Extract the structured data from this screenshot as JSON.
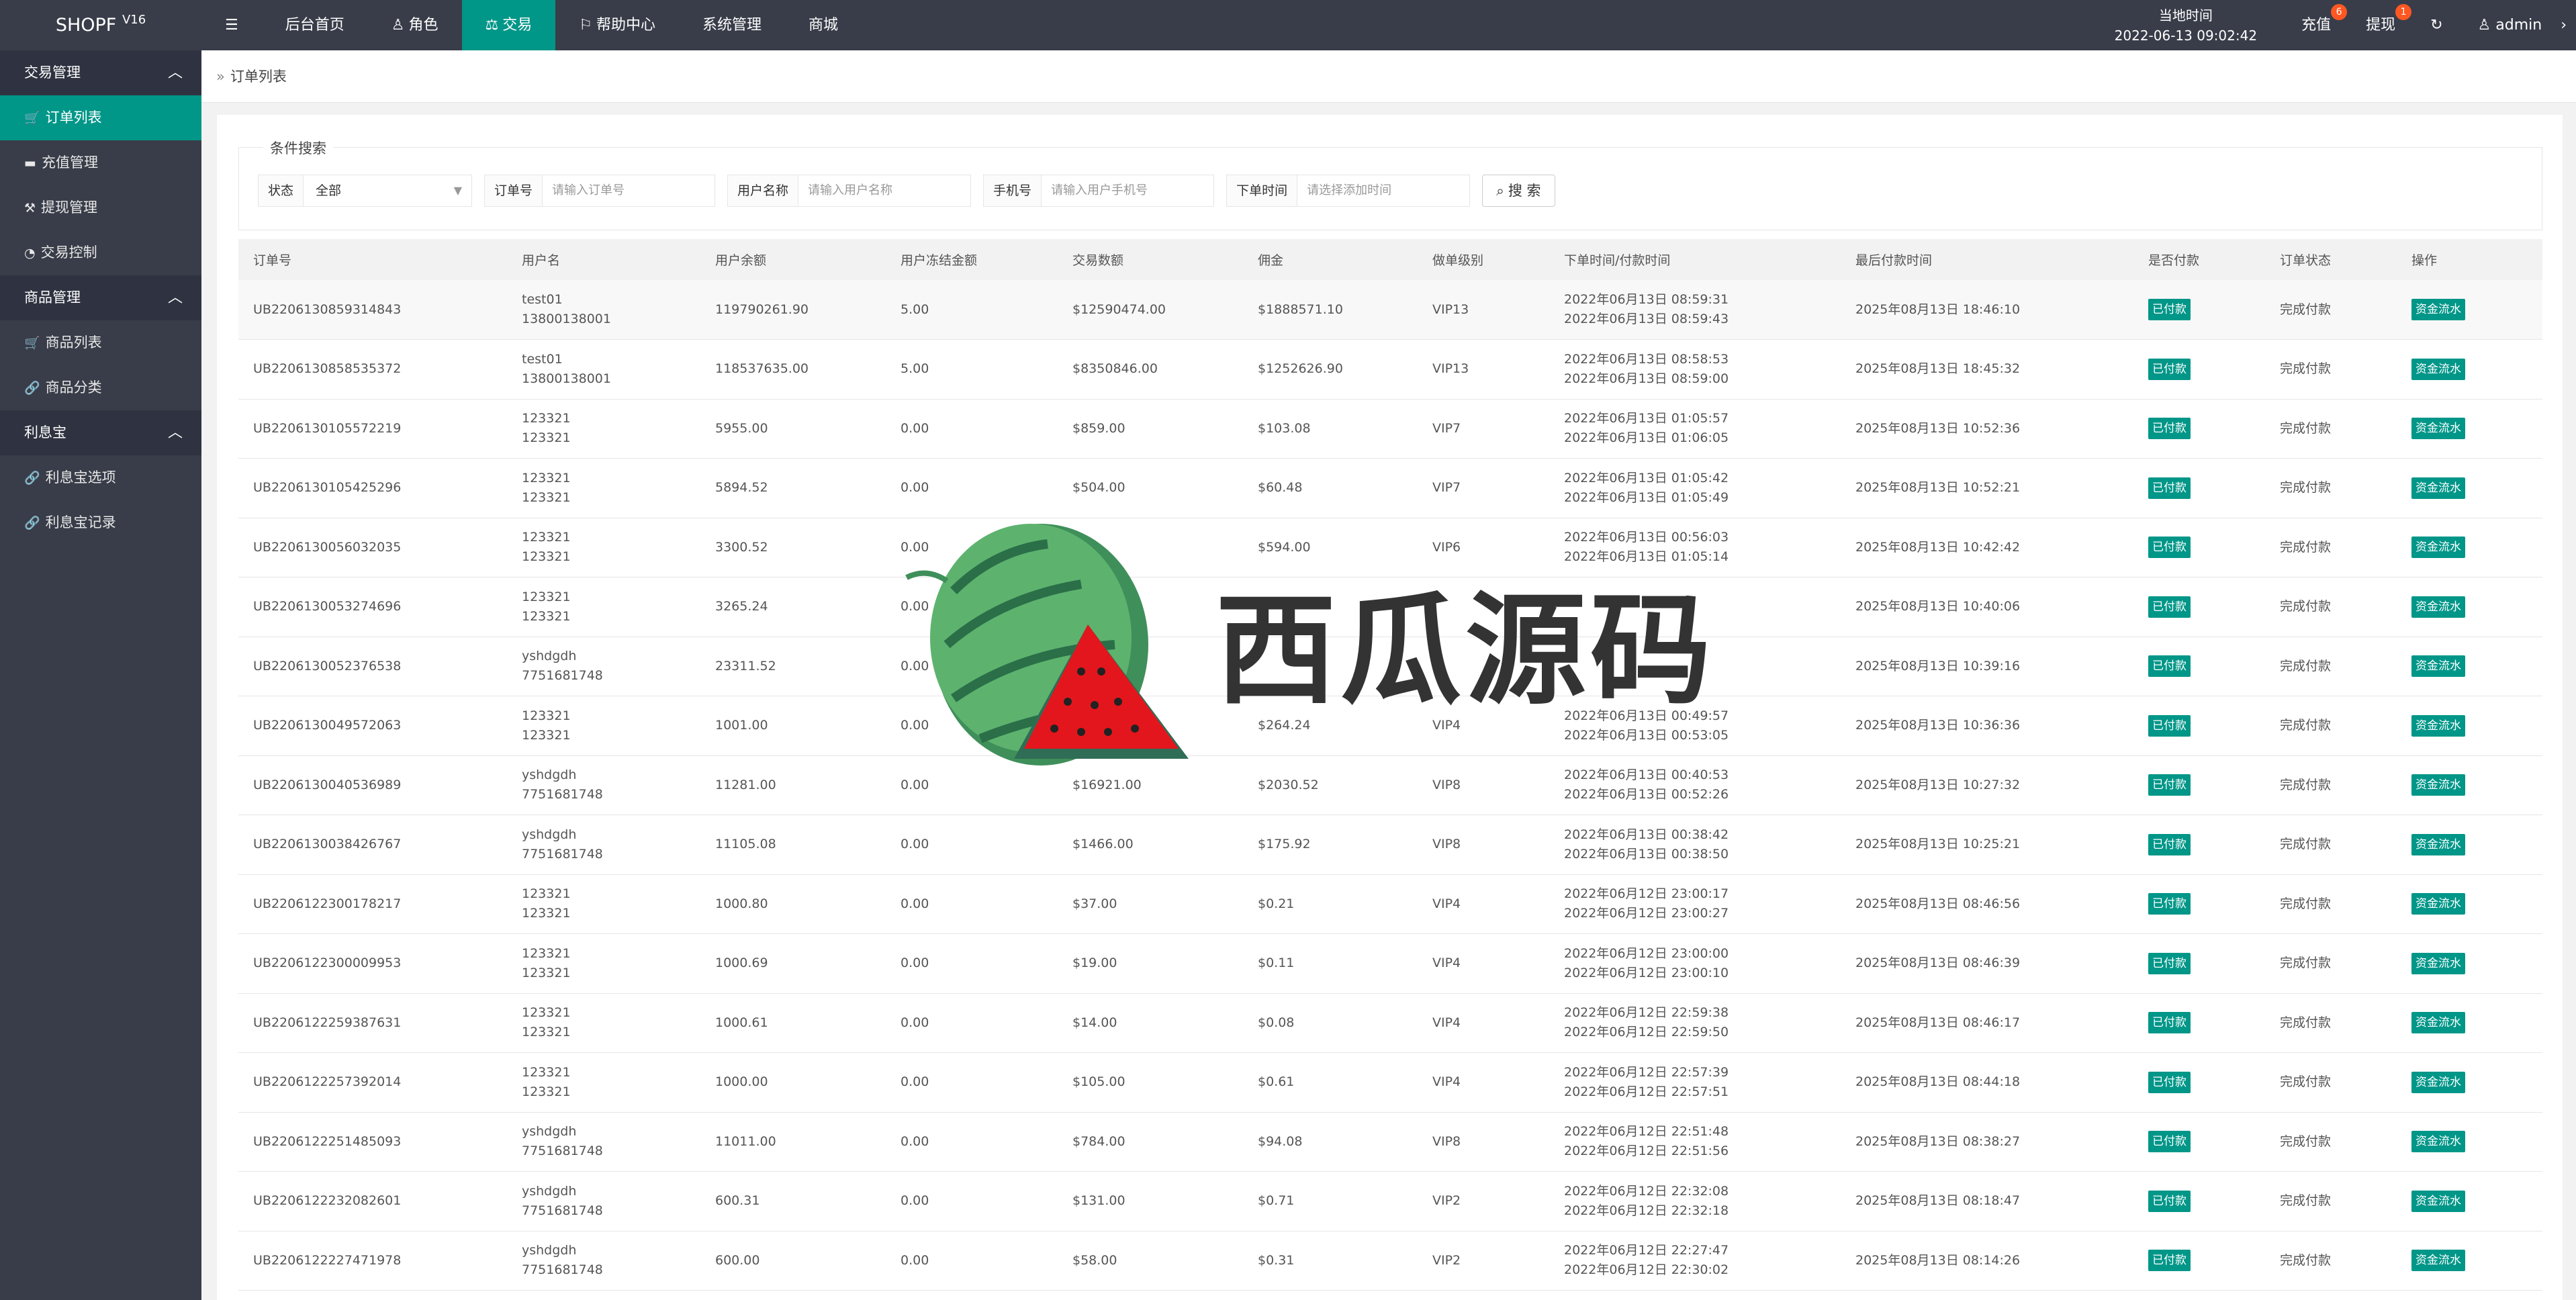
{
  "app": {
    "name": "SHOPF",
    "version": "V16"
  },
  "topnav": [
    {
      "label": "后台首页",
      "icon": ""
    },
    {
      "label": "角色",
      "icon": "user-icon"
    },
    {
      "label": "交易",
      "icon": "scale-icon",
      "active": true
    },
    {
      "label": "帮助中心",
      "icon": "flag-icon"
    },
    {
      "label": "系统管理",
      "icon": ""
    },
    {
      "label": "商城",
      "icon": ""
    }
  ],
  "header": {
    "clock_label": "当地时间",
    "clock_value": "2022-06-13 09:02:42",
    "recharge_label": "充值",
    "recharge_badge": "6",
    "withdraw_label": "提现",
    "withdraw_badge": "1",
    "user_label": "admin"
  },
  "sidebar": {
    "groups": [
      {
        "label": "交易管理",
        "items": [
          {
            "label": "订单列表",
            "icon": "cart-icon",
            "active": true
          },
          {
            "label": "充值管理",
            "icon": "comment-icon"
          },
          {
            "label": "提现管理",
            "icon": "hammer-icon"
          },
          {
            "label": "交易控制",
            "icon": "dashboard-icon"
          }
        ]
      },
      {
        "label": "商品管理",
        "items": [
          {
            "label": "商品列表",
            "icon": "cart-icon"
          },
          {
            "label": "商品分类",
            "icon": "link-icon"
          }
        ]
      },
      {
        "label": "利息宝",
        "items": [
          {
            "label": "利息宝选项",
            "icon": "link-icon"
          },
          {
            "label": "利息宝记录",
            "icon": "link-icon"
          }
        ]
      }
    ]
  },
  "breadcrumb": "订单列表",
  "search": {
    "legend": "条件搜索",
    "status_label": "状态",
    "status_value": "全部",
    "order_label": "订单号",
    "order_placeholder": "请输入订单号",
    "username_label": "用户名称",
    "username_placeholder": "请输入用户名称",
    "phone_label": "手机号",
    "phone_placeholder": "请输入用户手机号",
    "time_label": "下单时间",
    "time_placeholder": "请选择添加时间",
    "button_label": "搜 索"
  },
  "table": {
    "headers": [
      "订单号",
      "用户名",
      "用户余额",
      "用户冻结金额",
      "交易数额",
      "佣金",
      "做单级别",
      "下单时间/付款时间",
      "最后付款时间",
      "是否付款",
      "订单状态",
      "操作"
    ],
    "rows": [
      {
        "order": "UB2206130859314843",
        "user1": "test01",
        "user2": "13800138001",
        "balance": "119790261.90",
        "frozen": "5.00",
        "amount": "$12590474.00",
        "commission": "$1888571.10",
        "level": "VIP13",
        "t1": "2022年06月13日 08:59:31",
        "t2": "2022年06月13日 08:59:43",
        "last": "2025年08月13日 18:46:10",
        "paid": "已付款",
        "status": "完成付款",
        "action": "资金流水"
      },
      {
        "order": "UB2206130858535372",
        "user1": "test01",
        "user2": "13800138001",
        "balance": "118537635.00",
        "frozen": "5.00",
        "amount": "$8350846.00",
        "commission": "$1252626.90",
        "level": "VIP13",
        "t1": "2022年06月13日 08:58:53",
        "t2": "2022年06月13日 08:59:00",
        "last": "2025年08月13日 18:45:32",
        "paid": "已付款",
        "status": "完成付款",
        "action": "资金流水"
      },
      {
        "order": "UB2206130105572219",
        "user1": "123321",
        "user2": "123321",
        "balance": "5955.00",
        "frozen": "0.00",
        "amount": "$859.00",
        "commission": "$103.08",
        "level": "VIP7",
        "t1": "2022年06月13日 01:05:57",
        "t2": "2022年06月13日 01:06:05",
        "last": "2025年08月13日 10:52:36",
        "paid": "已付款",
        "status": "完成付款",
        "action": "资金流水"
      },
      {
        "order": "UB2206130105425296",
        "user1": "123321",
        "user2": "123321",
        "balance": "5894.52",
        "frozen": "0.00",
        "amount": "$504.00",
        "commission": "$60.48",
        "level": "VIP7",
        "t1": "2022年06月13日 01:05:42",
        "t2": "2022年06月13日 01:05:49",
        "last": "2025年08月13日 10:52:21",
        "paid": "已付款",
        "status": "完成付款",
        "action": "资金流水"
      },
      {
        "order": "UB2206130056032035",
        "user1": "123321",
        "user2": "123321",
        "balance": "3300.52",
        "frozen": "0.00",
        "amount": "",
        "commission": "$594.00",
        "level": "VIP6",
        "t1": "2022年06月13日 00:56:03",
        "t2": "2022年06月13日 01:05:14",
        "last": "2025年08月13日 10:42:42",
        "paid": "已付款",
        "status": "完成付款",
        "action": "资金流水"
      },
      {
        "order": "UB2206130053274696",
        "user1": "123321",
        "user2": "123321",
        "balance": "3265.24",
        "frozen": "0.00",
        "amount": "",
        "commission": "",
        "level": "",
        "t1": "",
        "t2": "",
        "last": "2025年08月13日 10:40:06",
        "paid": "已付款",
        "status": "完成付款",
        "action": "资金流水"
      },
      {
        "order": "UB2206130052376538",
        "user1": "yshdgdh",
        "user2": "7751681748",
        "balance": "23311.52",
        "frozen": "0.00",
        "amount": "",
        "commission": "",
        "level": "",
        "t1": "",
        "t2": "",
        "last": "2025年08月13日 10:39:16",
        "paid": "已付款",
        "status": "完成付款",
        "action": "资金流水"
      },
      {
        "order": "UB2206130049572063",
        "user1": "123321",
        "user2": "123321",
        "balance": "1001.00",
        "frozen": "0.00",
        "amount": "",
        "commission": "$264.24",
        "level": "VIP4",
        "t1": "2022年06月13日 00:49:57",
        "t2": "2022年06月13日 00:53:05",
        "last": "2025年08月13日 10:36:36",
        "paid": "已付款",
        "status": "完成付款",
        "action": "资金流水"
      },
      {
        "order": "UB2206130040536989",
        "user1": "yshdgdh",
        "user2": "7751681748",
        "balance": "11281.00",
        "frozen": "0.00",
        "amount": "$16921.00",
        "commission": "$2030.52",
        "level": "VIP8",
        "t1": "2022年06月13日 00:40:53",
        "t2": "2022年06月13日 00:52:26",
        "last": "2025年08月13日 10:27:32",
        "paid": "已付款",
        "status": "完成付款",
        "action": "资金流水"
      },
      {
        "order": "UB2206130038426767",
        "user1": "yshdgdh",
        "user2": "7751681748",
        "balance": "11105.08",
        "frozen": "0.00",
        "amount": "$1466.00",
        "commission": "$175.92",
        "level": "VIP8",
        "t1": "2022年06月13日 00:38:42",
        "t2": "2022年06月13日 00:38:50",
        "last": "2025年08月13日 10:25:21",
        "paid": "已付款",
        "status": "完成付款",
        "action": "资金流水"
      },
      {
        "order": "UB2206122300178217",
        "user1": "123321",
        "user2": "123321",
        "balance": "1000.80",
        "frozen": "0.00",
        "amount": "$37.00",
        "commission": "$0.21",
        "level": "VIP4",
        "t1": "2022年06月12日 23:00:17",
        "t2": "2022年06月12日 23:00:27",
        "last": "2025年08月13日 08:46:56",
        "paid": "已付款",
        "status": "完成付款",
        "action": "资金流水"
      },
      {
        "order": "UB2206122300009953",
        "user1": "123321",
        "user2": "123321",
        "balance": "1000.69",
        "frozen": "0.00",
        "amount": "$19.00",
        "commission": "$0.11",
        "level": "VIP4",
        "t1": "2022年06月12日 23:00:00",
        "t2": "2022年06月12日 23:00:10",
        "last": "2025年08月13日 08:46:39",
        "paid": "已付款",
        "status": "完成付款",
        "action": "资金流水"
      },
      {
        "order": "UB2206122259387631",
        "user1": "123321",
        "user2": "123321",
        "balance": "1000.61",
        "frozen": "0.00",
        "amount": "$14.00",
        "commission": "$0.08",
        "level": "VIP4",
        "t1": "2022年06月12日 22:59:38",
        "t2": "2022年06月12日 22:59:50",
        "last": "2025年08月13日 08:46:17",
        "paid": "已付款",
        "status": "完成付款",
        "action": "资金流水"
      },
      {
        "order": "UB2206122257392014",
        "user1": "123321",
        "user2": "123321",
        "balance": "1000.00",
        "frozen": "0.00",
        "amount": "$105.00",
        "commission": "$0.61",
        "level": "VIP4",
        "t1": "2022年06月12日 22:57:39",
        "t2": "2022年06月12日 22:57:51",
        "last": "2025年08月13日 08:44:18",
        "paid": "已付款",
        "status": "完成付款",
        "action": "资金流水"
      },
      {
        "order": "UB2206122251485093",
        "user1": "yshdgdh",
        "user2": "7751681748",
        "balance": "11011.00",
        "frozen": "0.00",
        "amount": "$784.00",
        "commission": "$94.08",
        "level": "VIP8",
        "t1": "2022年06月12日 22:51:48",
        "t2": "2022年06月12日 22:51:56",
        "last": "2025年08月13日 08:38:27",
        "paid": "已付款",
        "status": "完成付款",
        "action": "资金流水"
      },
      {
        "order": "UB2206122232082601",
        "user1": "yshdgdh",
        "user2": "7751681748",
        "balance": "600.31",
        "frozen": "0.00",
        "amount": "$131.00",
        "commission": "$0.71",
        "level": "VIP2",
        "t1": "2022年06月12日 22:32:08",
        "t2": "2022年06月12日 22:32:18",
        "last": "2025年08月13日 08:18:47",
        "paid": "已付款",
        "status": "完成付款",
        "action": "资金流水"
      },
      {
        "order": "UB2206122227471978",
        "user1": "yshdgdh",
        "user2": "7751681748",
        "balance": "600.00",
        "frozen": "0.00",
        "amount": "$58.00",
        "commission": "$0.31",
        "level": "VIP2",
        "t1": "2022年06月12日 22:27:47",
        "t2": "2022年06月12日 22:30:02",
        "last": "2025年08月13日 08:14:26",
        "paid": "已付款",
        "status": "完成付款",
        "action": "资金流水"
      }
    ]
  },
  "watermark": {
    "text": "西瓜源码"
  },
  "colors": {
    "topbar": "#393d49",
    "accent": "#009688",
    "badge": "#ff5722"
  }
}
